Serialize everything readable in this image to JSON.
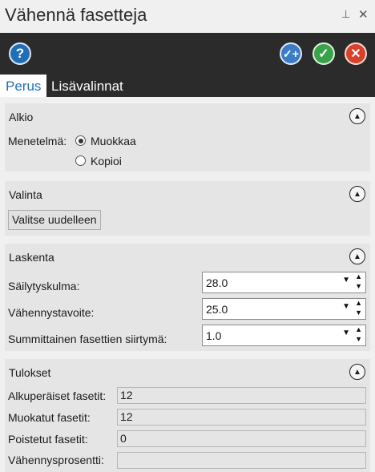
{
  "window": {
    "title": "Vähennä fasetteja",
    "pin_glyph": "⊥",
    "close_glyph": "✕"
  },
  "toolbar": {
    "help_icon": "?",
    "apply_plus_icon": "✓+",
    "ok_icon": "✓",
    "cancel_icon": "✕"
  },
  "tabs": [
    {
      "label": "Perus",
      "active": true
    },
    {
      "label": "Lisävalinnat",
      "active": false
    }
  ],
  "alkio": {
    "title": "Alkio",
    "method_label": "Menetelmä:",
    "options": [
      {
        "label": "Muokkaa",
        "checked": true
      },
      {
        "label": "Kopioi",
        "checked": false
      }
    ]
  },
  "valinta": {
    "title": "Valinta",
    "reselect_button": "Valitse uudelleen"
  },
  "laskenta": {
    "title": "Laskenta",
    "fields": [
      {
        "label": "Säilytyskulma:",
        "value": "28.0"
      },
      {
        "label": "Vähennystavoite:",
        "value": "25.0"
      },
      {
        "label": "Summittainen fasettien siirtymä:",
        "value": "1.0"
      }
    ]
  },
  "tulokset": {
    "title": "Tulokset",
    "fields": [
      {
        "label": "Alkuperäiset fasetit:",
        "value": "12"
      },
      {
        "label": "Muokatut fasetit:",
        "value": "12"
      },
      {
        "label": "Poistetut fasetit:",
        "value": "0"
      },
      {
        "label": "Vähennysprosentti:",
        "value": ""
      }
    ]
  },
  "colors": {
    "accent": "#1f6fb8",
    "toolbar_bg": "#2b2b2b",
    "ok": "#3aa34a",
    "cancel": "#d9412b"
  }
}
